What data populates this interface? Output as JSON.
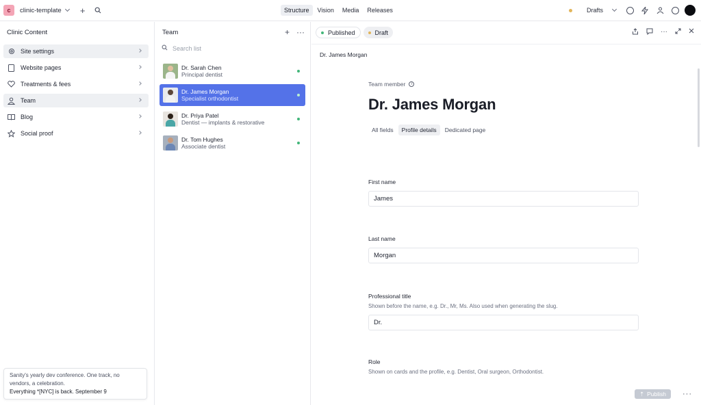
{
  "topbar": {
    "project_initial": "c",
    "project_name": "clinic-template",
    "nav": [
      "Structure",
      "Vision",
      "Media",
      "Releases"
    ],
    "active_nav": "Structure",
    "drafts_label": "Drafts"
  },
  "left": {
    "title": "Clinic Content",
    "items": [
      {
        "label": "Site settings",
        "icon": "gear-icon"
      },
      {
        "label": "Website pages",
        "icon": "document-icon"
      },
      {
        "label": "Treatments & fees",
        "icon": "heart-icon"
      },
      {
        "label": "Team",
        "icon": "user-icon"
      },
      {
        "label": "Blog",
        "icon": "book-icon"
      },
      {
        "label": "Social proof",
        "icon": "star-icon"
      }
    ],
    "promo": {
      "text": "Sanity's yearly dev conference. One track, no vendors, a celebration.",
      "strong": "Everything *[NYC] is back. September 9"
    }
  },
  "middle": {
    "title": "Team",
    "search_placeholder": "Search list",
    "rows": [
      {
        "name": "Dr. Sarah Chen",
        "role": "Principal dentist"
      },
      {
        "name": "Dr. James Morgan",
        "role": "Specialist orthodontist"
      },
      {
        "name": "Dr. Priya Patel",
        "role": "Dentist — implants & restorative"
      },
      {
        "name": "Dr. Tom Hughes",
        "role": "Associate dentist"
      }
    ]
  },
  "right": {
    "status": {
      "published": "Published",
      "draft": "Draft"
    },
    "breadcrumb": "Dr. James Morgan",
    "doc_type": "Team member",
    "title": "Dr. James Morgan",
    "tabs": [
      "All fields",
      "Profile details",
      "Dedicated page"
    ],
    "active_tab": "Profile details",
    "fields": {
      "first_name": {
        "label": "First name",
        "value": "James"
      },
      "last_name": {
        "label": "Last name",
        "value": "Morgan"
      },
      "title": {
        "label": "Professional title",
        "desc": "Shown before the name, e.g. Dr., Mr, Ms. Also used when generating the slug.",
        "value": "Dr."
      },
      "role": {
        "label": "Role",
        "desc": "Shown on cards and the profile, e.g. Dentist, Oral surgeon, Orthodontist."
      }
    },
    "publish_label": "Publish"
  },
  "colors": {
    "accent": "#5472e8",
    "published": "#43b67a",
    "draft": "#e2b55a"
  }
}
